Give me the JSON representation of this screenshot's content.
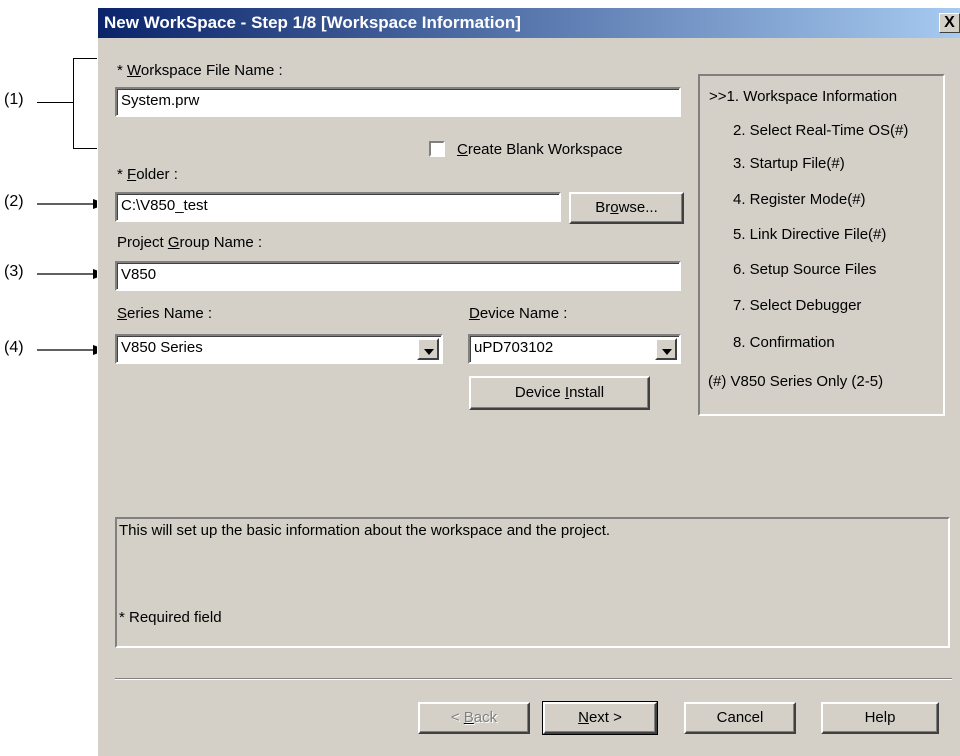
{
  "dialog": {
    "title": "New WorkSpace - Step 1/8 [Workspace Information]",
    "close_glyph": "X"
  },
  "form": {
    "workspace_file": {
      "label_prefix": "* ",
      "label_accel": "W",
      "label_rest": "orkspace File Name :",
      "value": "System.prw"
    },
    "blank_workspace": {
      "accel": "C",
      "rest": "reate Blank Workspace",
      "checked": false
    },
    "folder": {
      "label_prefix": "* ",
      "label_accel": "F",
      "label_rest": "older :",
      "value": "C:\\V850_test"
    },
    "browse_button": {
      "pre": "Br",
      "accel": "o",
      "post": "wse..."
    },
    "project_group": {
      "label_pre": "Project ",
      "label_accel": "G",
      "label_rest": "roup Name :",
      "value": "V850"
    },
    "series": {
      "label_accel": "S",
      "label_rest": "eries Name :",
      "value": "V850 Series"
    },
    "device": {
      "label_accel": "D",
      "label_rest": "evice Name :",
      "value": "uPD703102"
    },
    "device_install_button": {
      "pre": "Device ",
      "accel": "I",
      "post": "nstall"
    }
  },
  "steps": {
    "items": [
      ">>1. Workspace Information",
      "2. Select Real-Time OS(#)",
      "3. Startup File(#)",
      "4. Register Mode(#)",
      "5. Link Directive File(#)",
      "6. Setup Source Files",
      "7. Select Debugger",
      "8. Confirmation"
    ],
    "note": "(#) V850 Series Only (2-5)"
  },
  "description": {
    "text": "This will set up the basic information about the workspace and the project.",
    "required_note": "* Required field"
  },
  "buttons": {
    "back": {
      "accel": "B",
      "pre": "< ",
      "post": "ack"
    },
    "next": {
      "accel": "N",
      "post": "ext >"
    },
    "cancel": "Cancel",
    "help": "Help"
  },
  "callouts": [
    "(1)",
    "(2)",
    "(3)",
    "(4)"
  ]
}
